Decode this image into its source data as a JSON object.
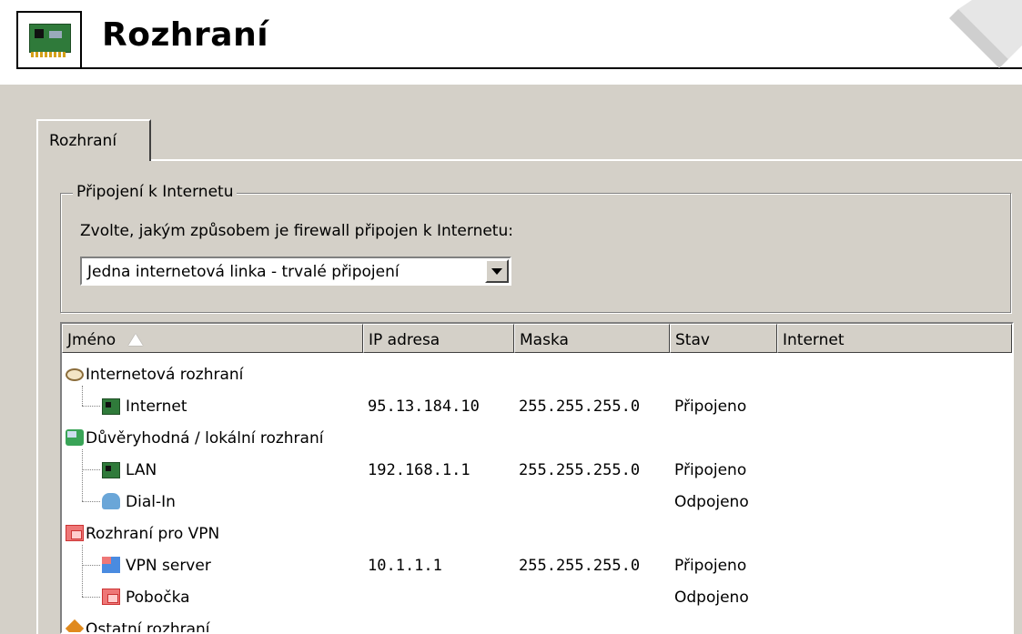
{
  "header": {
    "title": "Rozhraní",
    "icon": "network-card-icon"
  },
  "tabs": [
    {
      "label": "Rozhraní",
      "active": true
    }
  ],
  "internet_group": {
    "legend": "Připojení k Internetu",
    "description": "Zvolte, jakým způsobem je firewall připojen k Internetu:",
    "select_value": "Jedna internetová linka - trvalé připojení"
  },
  "table": {
    "columns": [
      "Jméno",
      "IP adresa",
      "Maska",
      "Stav",
      "Internet"
    ],
    "sort_column": "Jméno",
    "rows": [
      {
        "name": "Internetová rozhraní",
        "level": 0,
        "icon": "internet-cloud-icon",
        "ip": "",
        "mask": "",
        "status": "",
        "internet": ""
      },
      {
        "name": "Internet",
        "level": 1,
        "icon": "network-card-icon",
        "ip": "95.13.184.10",
        "mask": "255.255.255.0",
        "status": "Připojeno",
        "internet": ""
      },
      {
        "name": "Důvěryhodná / lokální rozhraní",
        "level": 0,
        "icon": "trusted-network-icon",
        "ip": "",
        "mask": "",
        "status": "",
        "internet": ""
      },
      {
        "name": "LAN",
        "level": 1,
        "icon": "network-card-icon",
        "ip": "192.168.1.1",
        "mask": "255.255.255.0",
        "status": "Připojeno",
        "internet": ""
      },
      {
        "name": "Dial-In",
        "level": 1,
        "icon": "dial-in-icon",
        "ip": "",
        "mask": "",
        "status": "Odpojeno",
        "internet": ""
      },
      {
        "name": "Rozhraní pro VPN",
        "level": 0,
        "icon": "vpn-icon",
        "ip": "",
        "mask": "",
        "status": "",
        "internet": ""
      },
      {
        "name": "VPN server",
        "level": 1,
        "icon": "vpn-server-icon",
        "ip": "10.1.1.1",
        "mask": "255.255.255.0",
        "status": "Připojeno",
        "internet": ""
      },
      {
        "name": "Pobočka",
        "level": 1,
        "icon": "vpn-tunnel-icon",
        "ip": "",
        "mask": "",
        "status": "Odpojeno",
        "internet": ""
      },
      {
        "name": "Ostatní rozhraní",
        "level": 0,
        "icon": "other-interfaces-icon",
        "ip": "",
        "mask": "",
        "status": "",
        "internet": ""
      }
    ]
  }
}
